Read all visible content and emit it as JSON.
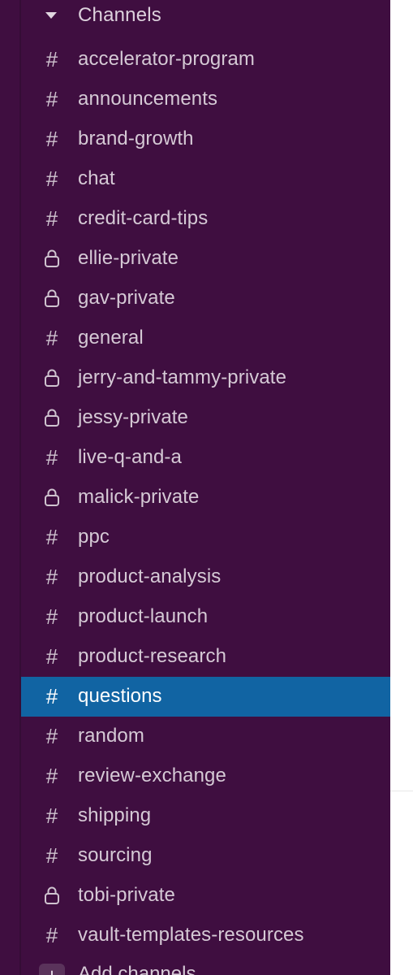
{
  "sidebar": {
    "section_title": "Channels",
    "channels": [
      {
        "name": "accelerator-program",
        "icon": "hash-icon",
        "private": false,
        "active": false
      },
      {
        "name": "announcements",
        "icon": "hash-icon",
        "private": false,
        "active": false
      },
      {
        "name": "brand-growth",
        "icon": "hash-icon",
        "private": false,
        "active": false
      },
      {
        "name": "chat",
        "icon": "hash-icon",
        "private": false,
        "active": false
      },
      {
        "name": "credit-card-tips",
        "icon": "hash-icon",
        "private": false,
        "active": false
      },
      {
        "name": "ellie-private",
        "icon": "lock-icon",
        "private": true,
        "active": false
      },
      {
        "name": "gav-private",
        "icon": "lock-icon",
        "private": true,
        "active": false
      },
      {
        "name": "general",
        "icon": "hash-icon",
        "private": false,
        "active": false
      },
      {
        "name": "jerry-and-tammy-private",
        "icon": "lock-icon",
        "private": true,
        "active": false
      },
      {
        "name": "jessy-private",
        "icon": "lock-icon",
        "private": true,
        "active": false
      },
      {
        "name": "live-q-and-a",
        "icon": "hash-icon",
        "private": false,
        "active": false
      },
      {
        "name": "malick-private",
        "icon": "lock-icon",
        "private": true,
        "active": false
      },
      {
        "name": "ppc",
        "icon": "hash-icon",
        "private": false,
        "active": false
      },
      {
        "name": "product-analysis",
        "icon": "hash-icon",
        "private": false,
        "active": false
      },
      {
        "name": "product-launch",
        "icon": "hash-icon",
        "private": false,
        "active": false
      },
      {
        "name": "product-research",
        "icon": "hash-icon",
        "private": false,
        "active": false
      },
      {
        "name": "questions",
        "icon": "hash-icon",
        "private": false,
        "active": true
      },
      {
        "name": "random",
        "icon": "hash-icon",
        "private": false,
        "active": false
      },
      {
        "name": "review-exchange",
        "icon": "hash-icon",
        "private": false,
        "active": false
      },
      {
        "name": "shipping",
        "icon": "hash-icon",
        "private": false,
        "active": false
      },
      {
        "name": "sourcing",
        "icon": "hash-icon",
        "private": false,
        "active": false
      },
      {
        "name": "tobi-private",
        "icon": "lock-icon",
        "private": true,
        "active": false
      },
      {
        "name": "vault-templates-resources",
        "icon": "hash-icon",
        "private": false,
        "active": false
      }
    ],
    "add_label": "Add channels",
    "add_icon": "plus-icon"
  },
  "colors": {
    "sidebar_bg": "#3f0e40",
    "active_bg": "#1164a3",
    "text": "#d5c9d5",
    "active_text": "#ffffff"
  }
}
